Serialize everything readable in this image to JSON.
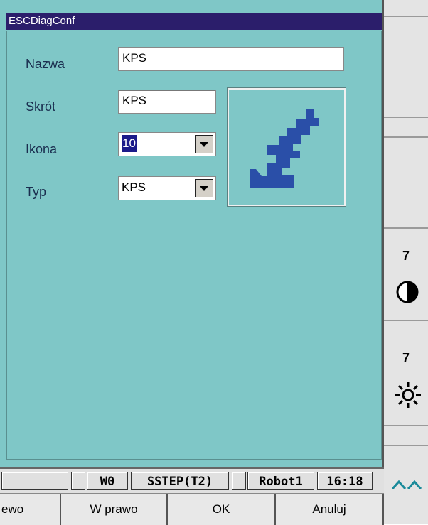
{
  "window": {
    "title": "ESCDiagConf"
  },
  "form": {
    "nazwa_label": "Nazwa",
    "nazwa_value": "KPS",
    "skrot_label": "Skrót",
    "skrot_value": "KPS",
    "ikona_label": "Ikona",
    "ikona_value": "10",
    "typ_label": "Typ",
    "typ_value": "KPS",
    "icon_preview": "lightning-arrow-icon"
  },
  "side": {
    "contrast_value": "7",
    "brightness_value": "7",
    "scroll_icon": "double-chevron-up-icon"
  },
  "status": {
    "mode": "W0",
    "step": "SSTEP(T2)",
    "robot": "Robot1",
    "time": "16:18"
  },
  "softkeys": {
    "left": "ewo",
    "right": "W prawo",
    "ok": "OK",
    "cancel": "Anuluj"
  },
  "colors": {
    "dialog_bg": "#7fc7c7",
    "titlebar": "#2b1e6b",
    "icon_blue": "#2a4fa8"
  }
}
